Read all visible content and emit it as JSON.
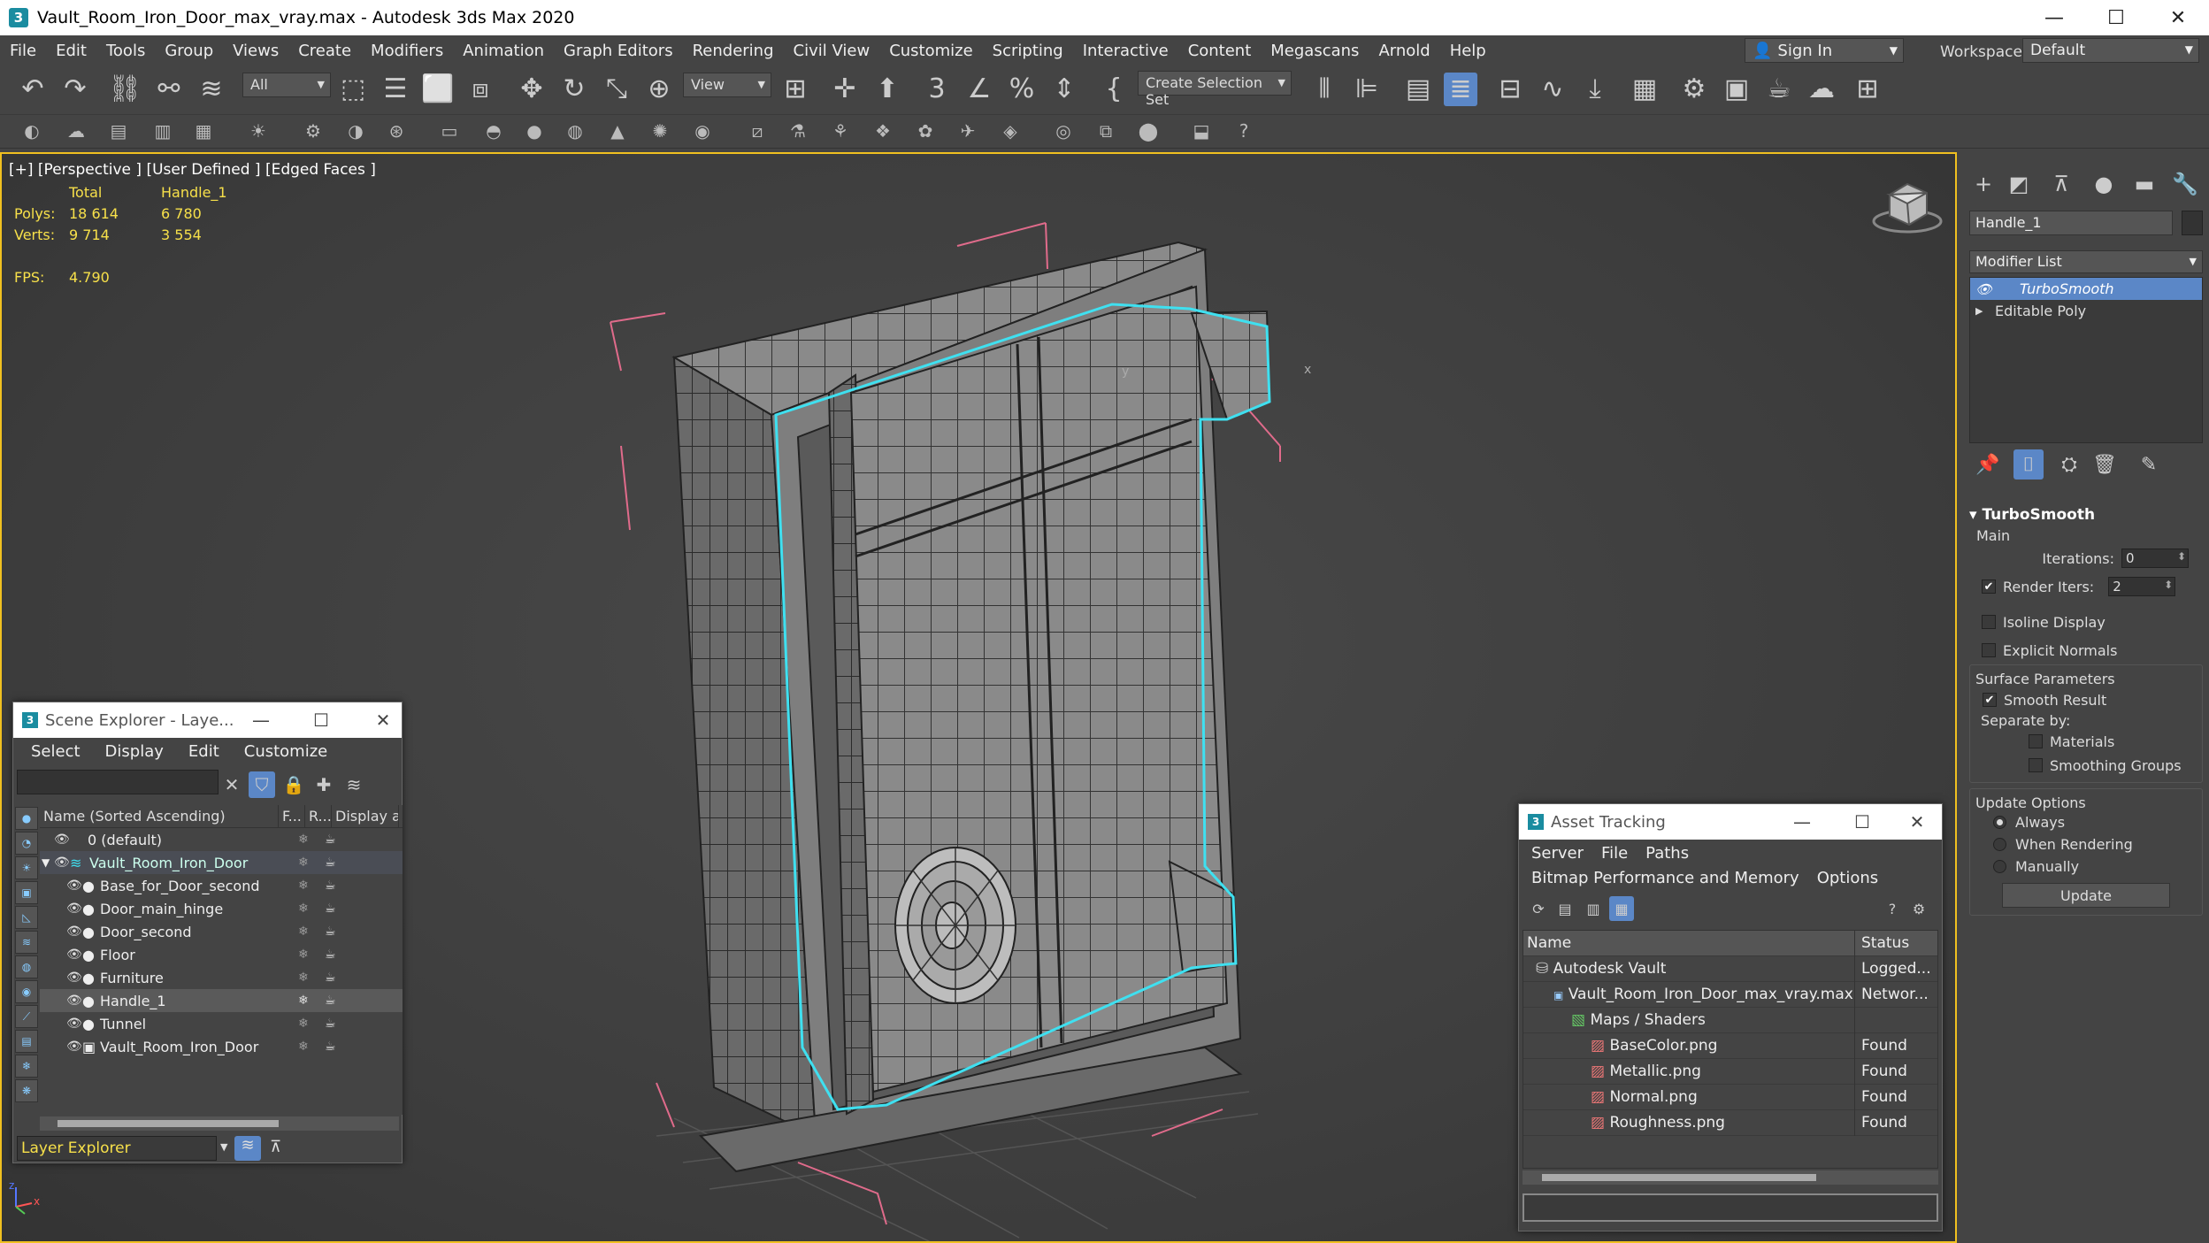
{
  "window": {
    "title": "Vault_Room_Iron_Door_max_vray.max - Autodesk 3ds Max 2020",
    "app_icon": "3",
    "minimize": "—",
    "maximize": "☐",
    "close": "✕"
  },
  "menu": [
    "File",
    "Edit",
    "Tools",
    "Group",
    "Views",
    "Create",
    "Modifiers",
    "Animation",
    "Graph Editors",
    "Rendering",
    "Civil View",
    "Customize",
    "Scripting",
    "Interactive",
    "Content",
    "Megascans",
    "Arnold",
    "Help"
  ],
  "signin": {
    "label": "Sign In"
  },
  "workspaces": {
    "label": "Workspaces:",
    "value": "Default"
  },
  "toolbar": {
    "filter_value": "All",
    "refcoord_value": "View",
    "selection_set_placeholder": "Create Selection Set"
  },
  "viewport": {
    "label": "[+] [Perspective ] [User Defined ] [Edged Faces ]",
    "stats": {
      "total_header": "Total",
      "object_header": "Handle_1",
      "polys_label": "Polys:",
      "polys_total": "18 614",
      "polys_obj": "6 780",
      "verts_label": "Verts:",
      "verts_total": "9 714",
      "verts_obj": "3 554",
      "fps_label": "FPS:",
      "fps_value": "4.790"
    },
    "axis_labels": {
      "x": "x",
      "y": "y",
      "z": "z"
    }
  },
  "command_panel": {
    "object_name": "Handle_1",
    "modifier_list": "Modifier List",
    "stack": [
      {
        "label": "TurboSmooth",
        "selected": true
      },
      {
        "label": "Editable Poly",
        "selected": false
      }
    ],
    "turbosmooth": {
      "title": "TurboSmooth",
      "main_label": "Main",
      "iterations_label": "Iterations:",
      "iterations_value": "0",
      "render_iters_label": "Render Iters:",
      "render_iters_value": "2",
      "isoline_label": "Isoline Display",
      "explicit_normals_label": "Explicit Normals",
      "surface_params_label": "Surface Parameters",
      "smooth_result_label": "Smooth Result",
      "separate_by_label": "Separate by:",
      "materials_label": "Materials",
      "smoothing_groups_label": "Smoothing Groups",
      "update_options_label": "Update Options",
      "always_label": "Always",
      "when_rendering_label": "When Rendering",
      "manually_label": "Manually",
      "update_button": "Update"
    }
  },
  "scene_explorer": {
    "title": "Scene Explorer - Laye...",
    "menu": [
      "Select",
      "Display",
      "Edit",
      "Customize"
    ],
    "columns": [
      "Name (Sorted Ascending)",
      "F...",
      "R...",
      "Display as"
    ],
    "rows": [
      {
        "name": "0 (default)",
        "indent": 1
      },
      {
        "name": "Vault_Room_Iron_Door",
        "indent": 0,
        "highlight": "parent"
      },
      {
        "name": "Base_for_Door_second",
        "indent": 2
      },
      {
        "name": "Door_main_hinge",
        "indent": 2
      },
      {
        "name": "Door_second",
        "indent": 2
      },
      {
        "name": "Floor",
        "indent": 2
      },
      {
        "name": "Furniture",
        "indent": 2
      },
      {
        "name": "Handle_1",
        "indent": 2,
        "highlight": "selected"
      },
      {
        "name": "Tunnel",
        "indent": 2
      },
      {
        "name": "Vault_Room_Iron_Door",
        "indent": 2
      }
    ],
    "explorer_type": "Layer Explorer"
  },
  "asset_tracking": {
    "title": "Asset Tracking",
    "menu": [
      "Server",
      "File",
      "Paths"
    ],
    "menu2": [
      "Bitmap Performance and Memory",
      "Options"
    ],
    "columns": [
      "Name",
      "Status"
    ],
    "rows": [
      {
        "name": "Autodesk Vault",
        "status": "Logged...",
        "indent": 0
      },
      {
        "name": "Vault_Room_Iron_Door_max_vray.max",
        "status": "Networ...",
        "indent": 1
      },
      {
        "name": "Maps / Shaders",
        "status": "",
        "indent": 2
      },
      {
        "name": "BaseColor.png",
        "status": "Found",
        "indent": 3
      },
      {
        "name": "Metallic.png",
        "status": "Found",
        "indent": 3
      },
      {
        "name": "Normal.png",
        "status": "Found",
        "indent": 3
      },
      {
        "name": "Roughness.png",
        "status": "Found",
        "indent": 3
      }
    ]
  },
  "colors": {
    "selection_outline": "#3fe0f0",
    "stats_text": "#f7e04a",
    "viewport_border": "#f0c020",
    "stack_selected": "#5b87c7"
  }
}
